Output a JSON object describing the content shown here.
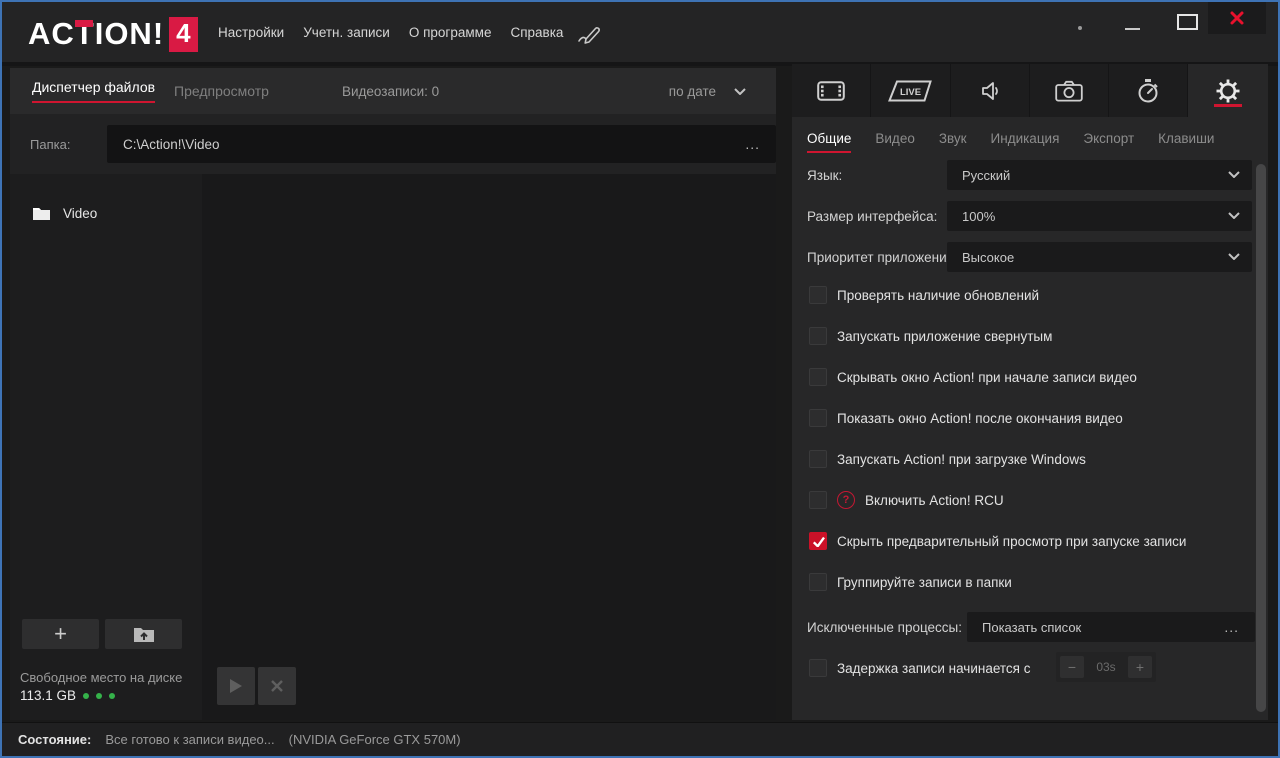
{
  "titlebar": {
    "logo_text": "ACTION!",
    "logo_badge": "4",
    "menu": [
      "Настройки",
      "Учетн. записи",
      "О программе",
      "Справка"
    ]
  },
  "file_manager": {
    "tab_files": "Диспетчер файлов",
    "tab_preview": "Предпросмотр",
    "counter": "Видеозаписи: 0",
    "sort": "по дате",
    "folder_label": "Папка:",
    "folder_path": "C:\\Action!\\Video",
    "tree_item": "Video",
    "free_space_label": "Свободное место на диске",
    "free_space_value": "113.1 GB"
  },
  "settings": {
    "live_label": "LIVE",
    "tabs": [
      "Общие",
      "Видео",
      "Звук",
      "Индикация",
      "Экспорт",
      "Клавиши"
    ],
    "dropdowns": [
      {
        "label": "Язык:",
        "value": "Русский"
      },
      {
        "label": "Размер интерфейса:",
        "value": "100%"
      },
      {
        "label": "Приоритет приложения",
        "value": "Высокое"
      }
    ],
    "checkboxes": [
      {
        "label": "Проверять наличие обновлений",
        "checked": false
      },
      {
        "label": "Запускать приложение свернутым",
        "checked": false
      },
      {
        "label": "Скрывать окно Action! при начале записи видео",
        "checked": false
      },
      {
        "label": "Показать окно Action! после окончания видео",
        "checked": false
      },
      {
        "label": "Запускать Action! при загрузке Windows",
        "checked": false
      },
      {
        "label": "Включить Action! RCU",
        "checked": false
      },
      {
        "label": "Скрыть предварительный просмотр при запуске записи",
        "checked": true
      },
      {
        "label": "Группируйте записи в папки",
        "checked": false
      }
    ],
    "excluded_label": "Исключенные процессы:",
    "excluded_value": "Показать список",
    "delay_label": "Задержка записи начинается с",
    "delay_value": "03s"
  },
  "statusbar": {
    "label": "Состояние:",
    "status": "Все готово к записи видео...",
    "gpu": "(NVIDIA GeForce GTX 570M)"
  },
  "icons": {
    "ellipsis": "...",
    "plus": "+",
    "minus": "−",
    "help": "?"
  },
  "colors": {
    "accent_red": "#cf1530",
    "logo_red": "#d91a44",
    "close_red": "#e8112d",
    "window_border_blue": "#3e73b5",
    "free_space_green": "#35b24a",
    "panel_dark": "#272728",
    "titlebar_bg": "#242425"
  }
}
